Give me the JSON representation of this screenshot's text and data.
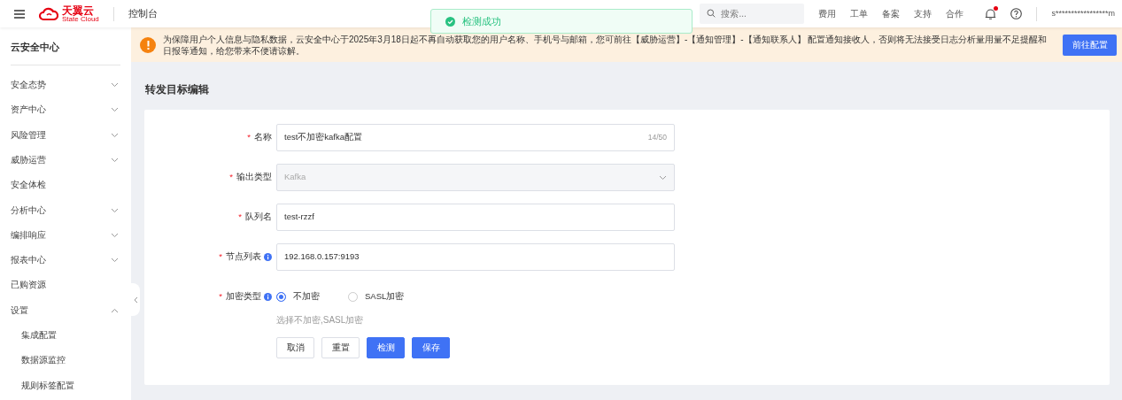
{
  "header": {
    "brand": "天翼云",
    "brand_sub": "State Cloud",
    "console": "控制台",
    "search": {
      "placeholder": "搜索..."
    },
    "links": [
      "费用",
      "工单",
      "备案",
      "支持",
      "合作"
    ],
    "notification_dot": true,
    "user": "s*****************m"
  },
  "toast": {
    "kind": "success",
    "text": "检测成功"
  },
  "sidebar": {
    "title": "云安全中心",
    "items": [
      {
        "label": "安全态势",
        "kind": "group",
        "expanded": false
      },
      {
        "label": "资产中心",
        "kind": "group",
        "expanded": false
      },
      {
        "label": "风险管理",
        "kind": "group",
        "expanded": false
      },
      {
        "label": "威胁运营",
        "kind": "group",
        "expanded": false
      },
      {
        "label": "安全体检",
        "kind": "link"
      },
      {
        "label": "分析中心",
        "kind": "group",
        "expanded": false
      },
      {
        "label": "编排响应",
        "kind": "group",
        "expanded": false
      },
      {
        "label": "报表中心",
        "kind": "group",
        "expanded": false
      },
      {
        "label": "已购资源",
        "kind": "link"
      },
      {
        "label": "设置",
        "kind": "group",
        "expanded": true,
        "children": [
          {
            "label": "集成配置"
          },
          {
            "label": "数据源监控"
          },
          {
            "label": "规则标签配置"
          }
        ]
      }
    ]
  },
  "banner": {
    "text": "为保障用户个人信息与隐私数据，云安全中心于2025年3月18日起不再自动获取您的用户名称、手机号与邮箱，您可前往【威胁运营】-【通知管理】-【通知联系人】 配置通知接收人，否则将无法接受日志分析量用量不足提醒和日报等通知，给您带来不便请谅解。",
    "button": "前往配置"
  },
  "page_title": "转发目标编辑",
  "form": {
    "fields": [
      {
        "kind": "text",
        "required_mark": "*",
        "label": "名称",
        "value": "test不加密kafka配置",
        "counter": "14/50"
      },
      {
        "kind": "select",
        "required_mark": "*",
        "label": "输出类型",
        "value": "Kafka",
        "disabled": true
      },
      {
        "kind": "text",
        "required_mark": "*",
        "label": "队列名",
        "value": "test-rzzf"
      },
      {
        "kind": "text",
        "required_mark": "*",
        "label": "节点列表",
        "info": true,
        "value": "192.168.0.157:9193"
      },
      {
        "kind": "radio",
        "required_mark": "*",
        "label": "加密类型",
        "info": true,
        "options": [
          {
            "label": "不加密",
            "selected": true
          },
          {
            "label": "SASL加密",
            "selected": false
          }
        ],
        "hint": "选择不加密,SASL加密"
      }
    ],
    "buttons": [
      {
        "label": "取消",
        "kind": "default"
      },
      {
        "label": "重置",
        "kind": "default"
      },
      {
        "label": "检测",
        "kind": "primary"
      },
      {
        "label": "保存",
        "kind": "primary"
      }
    ]
  }
}
